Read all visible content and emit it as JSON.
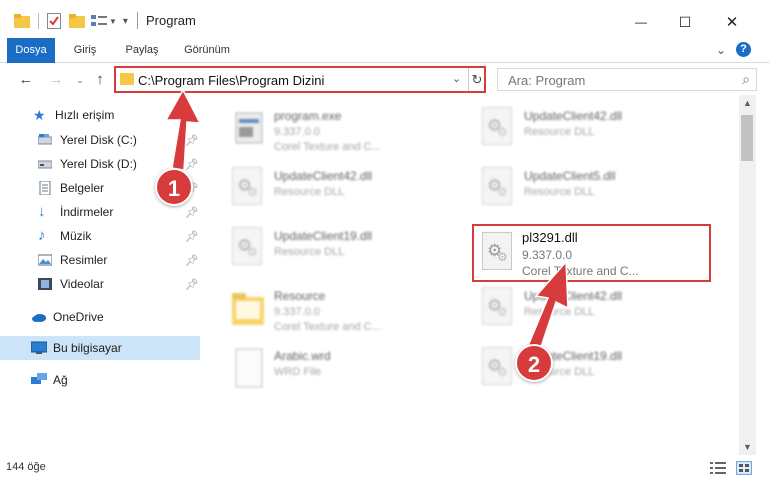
{
  "window": {
    "title": "Program",
    "controls": {
      "minimize": "—",
      "maximize": "☐",
      "close": "✕"
    }
  },
  "ribbon": {
    "tabs": [
      "Dosya",
      "Giriş",
      "Paylaş",
      "Görünüm"
    ],
    "help_label": "?"
  },
  "address_bar": {
    "path": "C:\\Program Files\\Program Dizini",
    "search_placeholder": "Ara: Program"
  },
  "sidebar": {
    "items": [
      {
        "label": "Hızlı erişim",
        "icon": "star-icon",
        "pinned": false
      },
      {
        "label": "Yerel Disk (C:)",
        "icon": "drive-icon",
        "pinned": true
      },
      {
        "label": "Yerel Disk (D:)",
        "icon": "drive-icon",
        "pinned": true
      },
      {
        "label": "Belgeler",
        "icon": "document-icon",
        "pinned": true
      },
      {
        "label": "İndirmeler",
        "icon": "download-icon",
        "pinned": true
      },
      {
        "label": "Müzik",
        "icon": "music-icon",
        "pinned": true
      },
      {
        "label": "Resimler",
        "icon": "picture-icon",
        "pinned": true
      },
      {
        "label": "Videolar",
        "icon": "video-icon",
        "pinned": true
      },
      {
        "label": "OneDrive",
        "icon": "cloud-icon",
        "pinned": false
      },
      {
        "label": "Bu bilgisayar",
        "icon": "computer-icon",
        "pinned": false,
        "selected": true
      },
      {
        "label": "Ağ",
        "icon": "network-icon",
        "pinned": false
      }
    ]
  },
  "files": {
    "left": [
      {
        "name": "program.exe",
        "line2": "9.337.0.0",
        "line3": "Corel Texture and C...",
        "type": "exe"
      },
      {
        "name": "UpdateClient42.dll",
        "line2": "Resource DLL",
        "line3": "",
        "type": "dll"
      },
      {
        "name": "UpdateClient19.dll",
        "line2": "Resource DLL",
        "line3": "",
        "type": "dll"
      },
      {
        "name": "Resource",
        "line2": "9.337.0.0",
        "line3": "Corel Texture and C...",
        "type": "folder"
      },
      {
        "name": "Arabic.wrd",
        "line2": "WRD File",
        "line3": "",
        "type": "file"
      }
    ],
    "right": [
      {
        "name": "UpdateClient42.dll",
        "line2": "Resource DLL",
        "line3": "",
        "type": "dll"
      },
      {
        "name": "UpdateClient5.dll",
        "line2": "Resource DLL",
        "line3": "",
        "type": "dll"
      },
      {
        "name": "UpdateClient42.dll",
        "line2": "Resource DLL",
        "line3": "",
        "type": "dll"
      },
      {
        "name": "UpdateClient19.dll",
        "line2": "Resource DLL",
        "line3": "",
        "type": "dll"
      }
    ],
    "highlighted": {
      "name": "pl3291.dll",
      "line2": "9.337.0.0",
      "line3": "Corel Texture and C..."
    }
  },
  "status": {
    "item_count": "144 öğe"
  },
  "annotations": {
    "step1": "1",
    "step2": "2",
    "color": "#d83b3b"
  }
}
